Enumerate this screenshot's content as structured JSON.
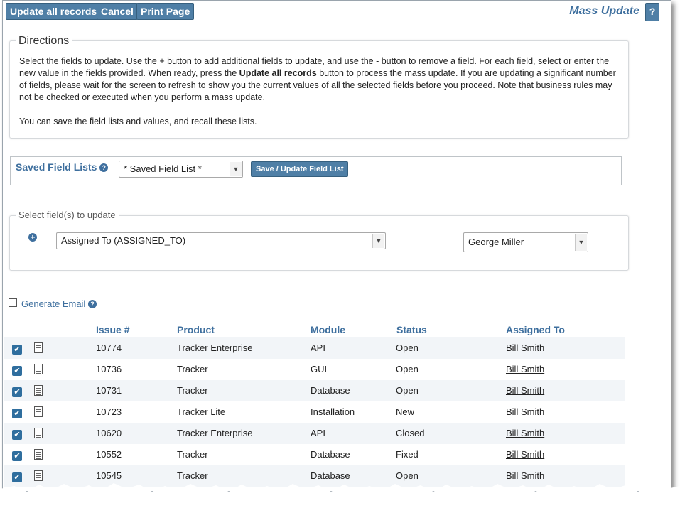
{
  "toolbar": {
    "update_all": "Update all records",
    "cancel": "Cancel",
    "print": "Print Page",
    "title": "Mass Update",
    "help": "?"
  },
  "directions": {
    "legend": "Directions",
    "para1_a": "Select the fields to update. Use the + button to add additional fields to update, and use the - button to remove a field. For each field, select or enter the new value in the fields provided. When ready, press the ",
    "para1_bold": "Update all records",
    "para1_b": " button to process the mass update. If you are updating a significant number of fields, please wait for the screen to refresh to show you the current values of all the selected fields before you proceed. Note that business rules may not be checked or executed when you perform a mass update.",
    "para2": "You can save the field lists and values, and recall these lists."
  },
  "saved_lists": {
    "label": "Saved Field Lists",
    "selected": "* Saved Field List *",
    "save_button": "Save / Update Field List"
  },
  "field_select": {
    "legend": "Select field(s) to update",
    "field": "Assigned To (ASSIGNED_TO)",
    "value": "George Miller"
  },
  "generate_email": {
    "label": "Generate Email",
    "checked": false
  },
  "table": {
    "headers": [
      "Issue #",
      "Product",
      "Module",
      "Status",
      "Assigned To"
    ],
    "rows": [
      {
        "issue": "10774",
        "product": "Tracker Enterprise",
        "module": "API",
        "status": "Open",
        "assigned": "Bill Smith"
      },
      {
        "issue": "10736",
        "product": "Tracker",
        "module": "GUI",
        "status": "Open",
        "assigned": "Bill Smith"
      },
      {
        "issue": "10731",
        "product": "Tracker",
        "module": "Database",
        "status": "Open",
        "assigned": "Bill Smith"
      },
      {
        "issue": "10723",
        "product": "Tracker Lite",
        "module": "Installation",
        "status": "New",
        "assigned": "Bill Smith"
      },
      {
        "issue": "10620",
        "product": "Tracker Enterprise",
        "module": "API",
        "status": "Closed",
        "assigned": "Bill Smith"
      },
      {
        "issue": "10552",
        "product": "Tracker",
        "module": "Database",
        "status": "Fixed",
        "assigned": "Bill Smith"
      },
      {
        "issue": "10545",
        "product": "Tracker",
        "module": "Database",
        "status": "Open",
        "assigned": "Bill Smith"
      }
    ]
  },
  "colors": {
    "accent": "#3e6f9e",
    "button": "#4f7fa6",
    "alt_row": "#f2f5f8"
  }
}
